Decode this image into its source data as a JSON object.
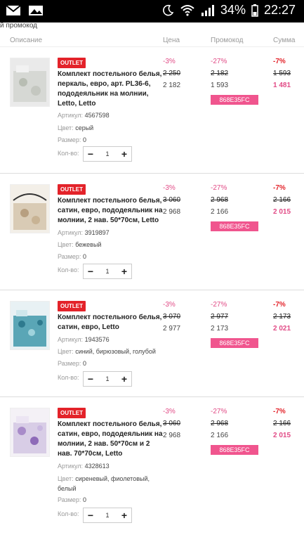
{
  "statusbar": {
    "battery": "34%",
    "time": "22:27"
  },
  "promo_link": "й промокод",
  "header": {
    "desc": "Описание",
    "price": "Цена",
    "promo": "Промокод",
    "sum": "Сумма"
  },
  "labels": {
    "outlet": "OUTLET",
    "article": "Артикул:",
    "color": "Цвет:",
    "size": "Размер:",
    "qty": "Кол-во:",
    "minus": "−",
    "plus": "+"
  },
  "items": [
    {
      "title": "Комплект постельного белья, перкаль, евро, арт. PL36-6, пододеяльник на молнии, Letto, Letto",
      "article": "4567598",
      "color": "серый",
      "size": "0",
      "qty": "1",
      "price_pct": "-3%",
      "price_old": "2 250",
      "price_new": "2 182",
      "promo_pct": "-27%",
      "promo_old": "2 182",
      "promo_new": "1 593",
      "promo_code": "868E35FC",
      "sum_pct": "-7%",
      "sum_old": "1 593",
      "sum_new": "1 481"
    },
    {
      "title": "Комплект постельного белья, сатин, евро, пододеяльник на молнии, 2 нав. 50*70см, Letto",
      "article": "3919897",
      "color": "бежевый",
      "size": "0",
      "qty": "1",
      "price_pct": "-3%",
      "price_old": "3 060",
      "price_new": "2 968",
      "promo_pct": "-27%",
      "promo_old": "2 968",
      "promo_new": "2 166",
      "promo_code": "868E35FC",
      "sum_pct": "-7%",
      "sum_old": "2 166",
      "sum_new": "2 015"
    },
    {
      "title": "Комплект постельного белья, сатин, евро, Letto",
      "article": "1943576",
      "color": "синий, бирюзовый, голубой",
      "size": "0",
      "qty": "1",
      "price_pct": "-3%",
      "price_old": "3 070",
      "price_new": "2 977",
      "promo_pct": "-27%",
      "promo_old": "2 977",
      "promo_new": "2 173",
      "promo_code": "868E35FC",
      "sum_pct": "-7%",
      "sum_old": "2 173",
      "sum_new": "2 021"
    },
    {
      "title": "Комплект постельного белья, сатин, евро, пододеяльник на молнии, 2 нав. 50*70см и 2 нав. 70*70см, Letto",
      "article": "4328613",
      "color": "сиреневый, фиолетовый, белый",
      "size": "0",
      "qty": "1",
      "price_pct": "-3%",
      "price_old": "3 060",
      "price_new": "2 968",
      "promo_pct": "-27%",
      "promo_old": "2 968",
      "promo_new": "2 166",
      "promo_code": "868E35FC",
      "sum_pct": "-7%",
      "sum_old": "2 166",
      "sum_new": "2 015"
    }
  ]
}
